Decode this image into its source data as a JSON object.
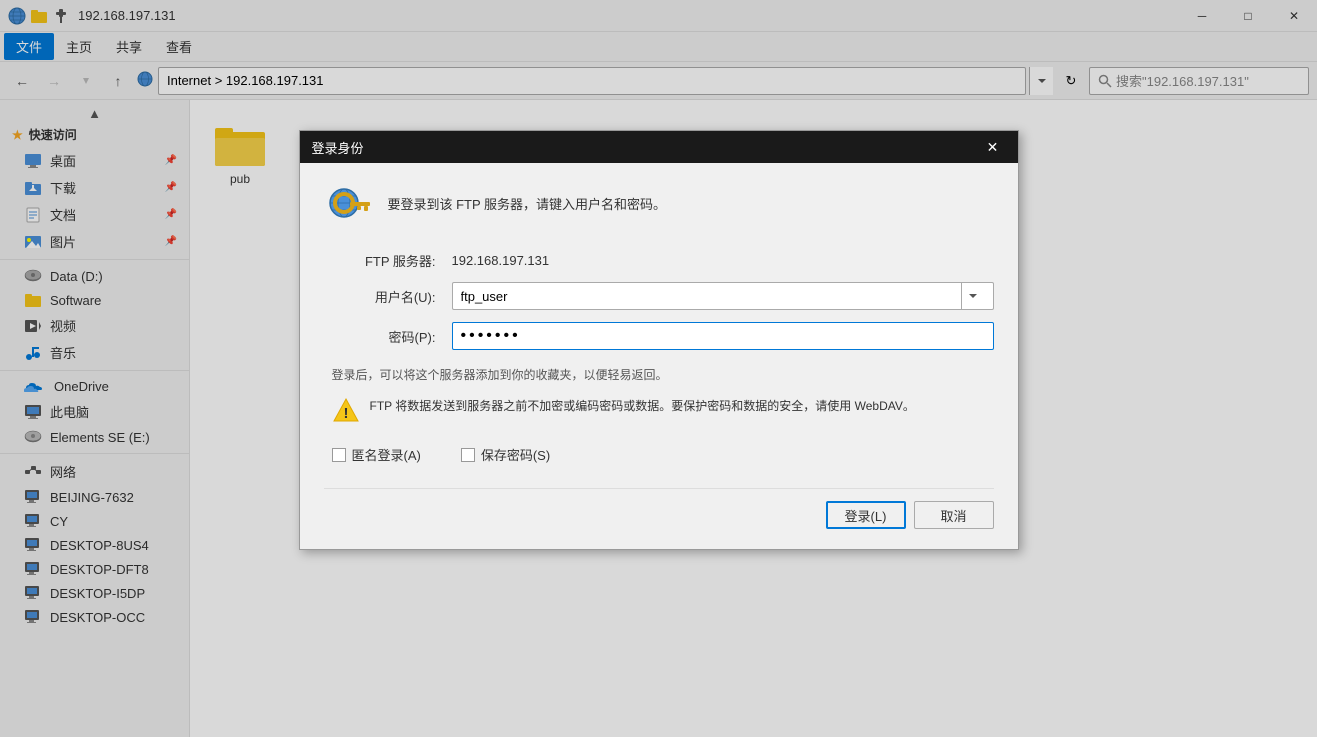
{
  "window": {
    "title": "192.168.197.131",
    "address": "192.168.197.131",
    "breadcrumb": "Internet > 192.168.197.131",
    "search_placeholder": "搜索\"192.168.197.131\"",
    "min_btn": "─",
    "max_btn": "□",
    "close_btn": "✕"
  },
  "menubar": {
    "items": [
      "文件",
      "主页",
      "共享",
      "查看"
    ]
  },
  "navigation": {
    "back": "←",
    "forward": "→",
    "up_arrow": "↑",
    "dropdown": "▾",
    "refresh": "↻"
  },
  "sidebar": {
    "scroll_up": "▲",
    "quick_access_label": "★ 快速访问",
    "items": [
      {
        "label": "桌面",
        "type": "desktop",
        "pinned": true
      },
      {
        "label": "下载",
        "type": "download",
        "pinned": true
      },
      {
        "label": "文档",
        "type": "docs",
        "pinned": true
      },
      {
        "label": "图片",
        "type": "pics",
        "pinned": true
      },
      {
        "label": "Data (D:)",
        "type": "drive"
      },
      {
        "label": "Software",
        "type": "folder"
      },
      {
        "label": "视频",
        "type": "video"
      },
      {
        "label": "音乐",
        "type": "music"
      }
    ],
    "onedrive_label": "OneDrive",
    "computer_label": "此电脑",
    "elements_se_label": "Elements SE (E:)",
    "network_label": "网络",
    "network_items": [
      {
        "label": "BEIJING-7632"
      },
      {
        "label": "CY"
      },
      {
        "label": "DESKTOP-8US4"
      },
      {
        "label": "DESKTOP-DFT8"
      },
      {
        "label": "DESKTOP-I5DP"
      },
      {
        "label": "DESKTOP-OCC"
      }
    ]
  },
  "content": {
    "folder_name": "pub"
  },
  "dialog": {
    "title": "登录身份",
    "close_btn": "✕",
    "header_text": "要登录到该 FTP 服务器，请键入用户名和密码。",
    "ftp_server_label": "FTP 服务器:",
    "ftp_server_value": "192.168.197.131",
    "username_label": "用户名(U):",
    "username_value": "ftp_user",
    "username_dropdown": "▾",
    "password_label": "密码(P):",
    "password_value": "•••••••",
    "notice_text": "登录后，可以将这个服务器添加到你的收藏夹，以便轻易返回。",
    "warning_text": "FTP 将数据发送到服务器之前不加密或编码密码或数据。要保护密码和数据的安全，请使用 WebDAV。",
    "anonymous_label": "匿名登录(A)",
    "save_password_label": "保存密码(S)",
    "login_btn": "登录(L)",
    "cancel_btn": "取消"
  }
}
